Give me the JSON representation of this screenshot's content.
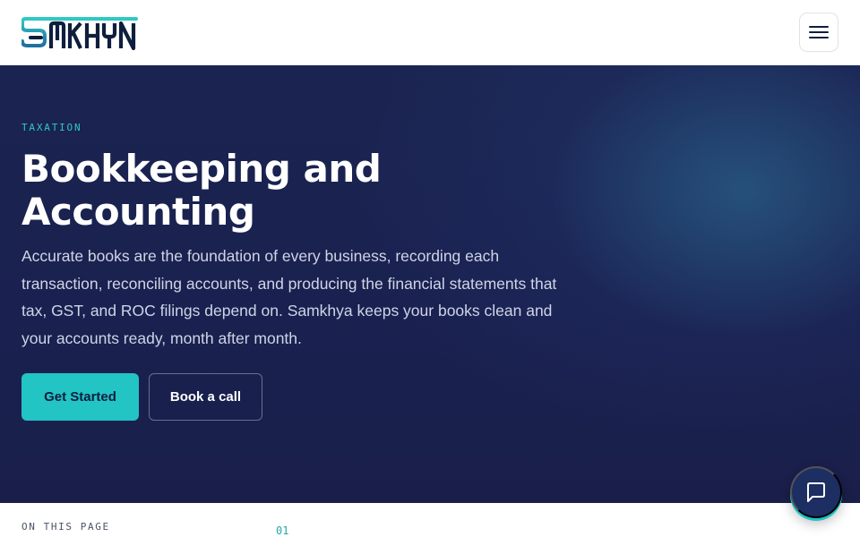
{
  "header": {
    "logo_text": "SAMKHYA",
    "menu_icon": "hamburger-menu-icon"
  },
  "hero": {
    "eyebrow": "TAXATION",
    "title": "Bookkeeping and Accounting",
    "description": "Accurate books are the foundation of every business, recording each transaction, reconciling accounts, and producing the financial statements that tax, GST, and ROC filings depend on. Samkhya keeps your books clean and your accounts ready, month after month.",
    "primary_button": "Get Started",
    "secondary_button": "Book a call"
  },
  "on_this_page": {
    "label": "ON THIS PAGE",
    "first_index": "01"
  },
  "chat": {
    "icon": "chat-bubble-icon"
  },
  "colors": {
    "brand_navy": "#1b2450",
    "accent_teal": "#22c4c4",
    "logo_dark": "#0f1e3d"
  }
}
